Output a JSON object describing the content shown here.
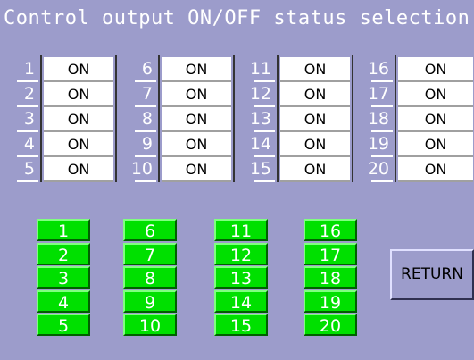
{
  "title": "Control output ON/OFF status selection",
  "status_groups": [
    {
      "rows": [
        {
          "num": "1",
          "value": "ON"
        },
        {
          "num": "2",
          "value": "ON"
        },
        {
          "num": "3",
          "value": "ON"
        },
        {
          "num": "4",
          "value": "ON"
        },
        {
          "num": "5",
          "value": "ON"
        }
      ]
    },
    {
      "rows": [
        {
          "num": "6",
          "value": "ON"
        },
        {
          "num": "7",
          "value": "ON"
        },
        {
          "num": "8",
          "value": "ON"
        },
        {
          "num": "9",
          "value": "ON"
        },
        {
          "num": "10",
          "value": "ON"
        }
      ]
    },
    {
      "rows": [
        {
          "num": "11",
          "value": "ON"
        },
        {
          "num": "12",
          "value": "ON"
        },
        {
          "num": "13",
          "value": "ON"
        },
        {
          "num": "14",
          "value": "ON"
        },
        {
          "num": "15",
          "value": "ON"
        }
      ]
    },
    {
      "rows": [
        {
          "num": "16",
          "value": "ON"
        },
        {
          "num": "17",
          "value": "ON"
        },
        {
          "num": "18",
          "value": "ON"
        },
        {
          "num": "19",
          "value": "ON"
        },
        {
          "num": "20",
          "value": "ON"
        }
      ]
    }
  ],
  "buttons": [
    [
      "1",
      "2",
      "3",
      "4",
      "5"
    ],
    [
      "6",
      "7",
      "8",
      "9",
      "10"
    ],
    [
      "11",
      "12",
      "13",
      "14",
      "15"
    ],
    [
      "16",
      "17",
      "18",
      "19",
      "20"
    ]
  ],
  "return_label": "RETURN",
  "colors": {
    "background": "#9c9ccb",
    "button_green": "#00e000",
    "cell_bg": "#ffffff"
  }
}
